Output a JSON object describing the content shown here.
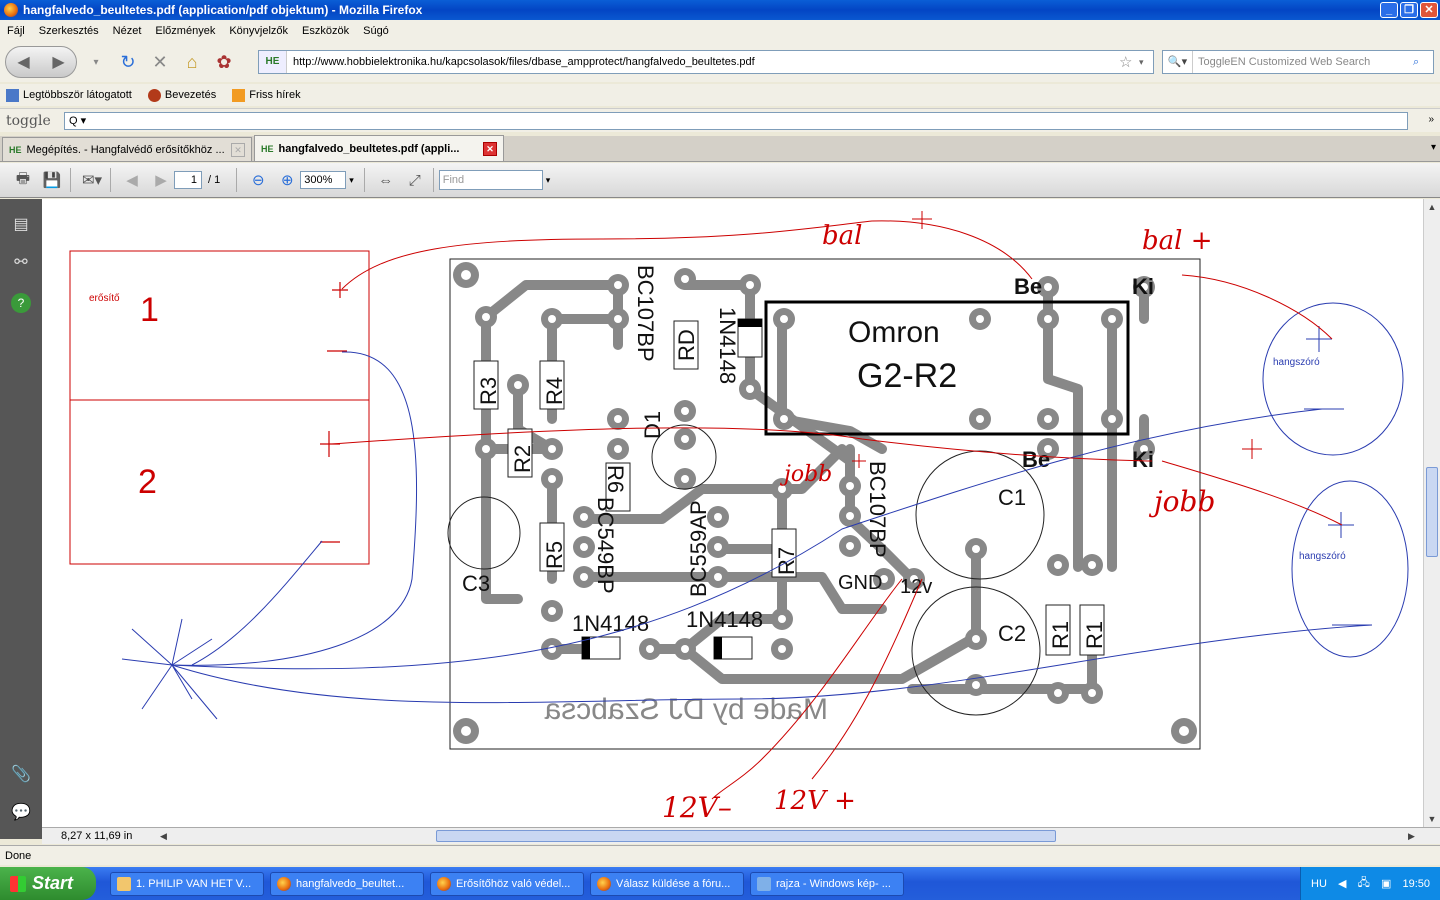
{
  "window": {
    "title": "hangfalvedo_beultetes.pdf (application/pdf objektum) - Mozilla Firefox"
  },
  "menu": [
    "Fájl",
    "Szerkesztés",
    "Nézet",
    "Előzmények",
    "Könyvjelzők",
    "Eszközök",
    "Súgó"
  ],
  "nav": {
    "url": "http://www.hobbielektronika.hu/kapcsolasok/files/dbase_ampprotect/hangfalvedo_beultetes.pdf",
    "site_badge": "HE",
    "search_placeholder": "ToggleEN Customized Web Search"
  },
  "bookmarks": [
    "Legtöbbször látogatott",
    "Bevezetés",
    "Friss hírek"
  ],
  "toggle": {
    "logo": "toggle",
    "input": "Q ▾"
  },
  "tabs": [
    {
      "label": "Megépítés. - Hangfalvédő erősítőkhöz ...",
      "active": false
    },
    {
      "label": "hangfalvedo_beultetes.pdf (appli...",
      "active": true
    }
  ],
  "pdf_toolbar": {
    "page": "1",
    "page_total": "/ 1",
    "zoom": "300%",
    "find_placeholder": "Find"
  },
  "pdf_bottom": {
    "page_size": "8,27 x 11,69 in"
  },
  "status": "Done",
  "taskbar": {
    "start": "Start",
    "items": [
      "1. PHILIP VAN HET V...",
      "hangfalvedo_beultet...",
      "Erősítőhöz való védel...",
      "Válasz küldése a fóru...",
      "rajza - Windows kép- ..."
    ],
    "lang": "HU",
    "time": "19:50"
  },
  "drawing": {
    "amp_label": "erősítő",
    "amp_ch1": "1",
    "amp_ch2": "2",
    "speaker_label": "hangszóró",
    "relay_brand": "Omron",
    "relay_model": "G2-R2",
    "relay_in_top": "Be",
    "relay_out_top": "Ki",
    "relay_in_bottom": "Be",
    "relay_out_bottom": "Ki",
    "parts": {
      "bc107_top": "BC107BP",
      "rd": "RD",
      "d1n4148_top": "1N4148",
      "r3": "R3",
      "r4": "R4",
      "r2": "R2",
      "d1": "D1",
      "r6": "R6",
      "bc549": "BC549BP",
      "bc559": "BC559AP",
      "r7": "R7",
      "bc107_bottom": "BC107BP",
      "r5": "R5",
      "c3": "C3",
      "c1": "C1",
      "c2": "C2",
      "r1a": "R1",
      "r1b": "R1",
      "gnd": "GND",
      "v12": "12v",
      "d_bottom1": "1N4148",
      "d_bottom2": "1N4148"
    },
    "credit": "Made by DJ Szabcsa",
    "notes": {
      "bal_top": "bal",
      "bal_right": "bal +",
      "jobb_mid": "jobb",
      "jobb_right": "jobb",
      "plus": "+",
      "v12_minus": "12V–",
      "v12_plus": "12V +"
    }
  }
}
